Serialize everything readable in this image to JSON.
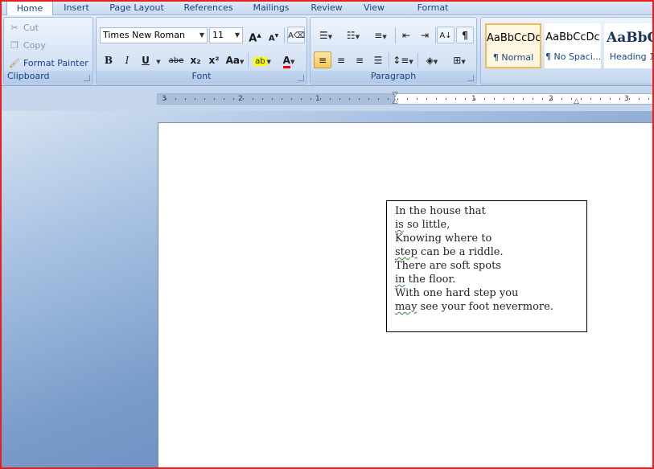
{
  "tabs": [
    "Home",
    "Insert",
    "Page Layout",
    "References",
    "Mailings",
    "Review",
    "View",
    "Format"
  ],
  "clipboard": {
    "label": "Clipboard",
    "cut": "Cut",
    "copy": "Copy",
    "format_painter": "Format Painter"
  },
  "font": {
    "label": "Font",
    "family": "Times New Roman",
    "size": "11",
    "buttons": {
      "bold": "B",
      "italic": "I",
      "underline": "U",
      "strike": "abe",
      "subscript": "x₂",
      "superscript": "x²",
      "change_case": "Aa",
      "grow": "A",
      "shrink": "A",
      "font_color": "A"
    }
  },
  "paragraph": {
    "label": "Paragraph"
  },
  "styles": [
    {
      "sample": "AaBbCcDc",
      "name": "¶ Normal",
      "selected": true
    },
    {
      "sample": "AaBbCcDc",
      "name": "¶ No Spaci...",
      "selected": false
    },
    {
      "sample": "AaBbC",
      "name": "Heading 1",
      "selected": false
    }
  ],
  "ruler": {
    "labels": [
      "3",
      "2",
      "1",
      "1",
      "2",
      "3"
    ]
  },
  "document": {
    "textbox_lines": [
      {
        "first": "In",
        "rest": " the house that",
        "squiggle": false
      },
      {
        "first": "is",
        "rest": " so little,",
        "squiggle": true
      },
      {
        "first": "Knowing",
        "rest": " where to",
        "squiggle": false
      },
      {
        "first": "step",
        "rest": " can be a riddle.",
        "squiggle": true
      },
      {
        "first": "There",
        "rest": " are soft spots",
        "squiggle": false
      },
      {
        "first": "in",
        "rest": " the floor.",
        "squiggle": true
      },
      {
        "first": "With",
        "rest": " one hard step you",
        "squiggle": false
      },
      {
        "first": "may",
        "rest": " see your foot nevermore.",
        "squiggle": true
      }
    ]
  },
  "colors": {
    "accent": "#15428b",
    "highlight": "#ffff00",
    "font_color_bar": "#ff0000",
    "frame_border": "#e5201e"
  }
}
